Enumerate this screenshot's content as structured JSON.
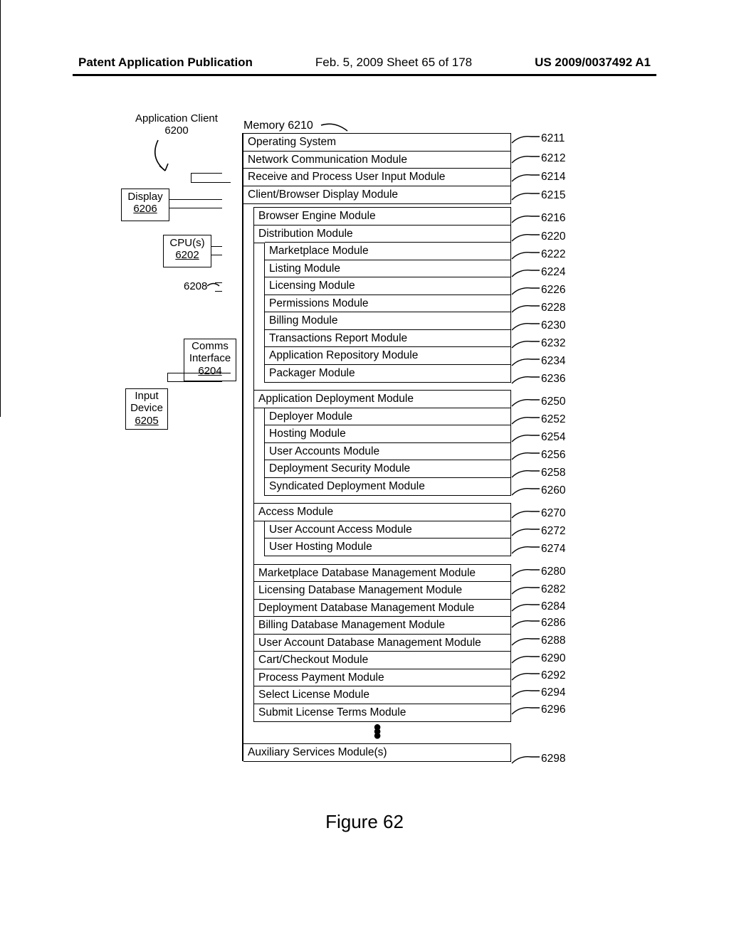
{
  "header": {
    "left": "Patent Application Publication",
    "center": "Feb. 5, 2009   Sheet 65 of 178",
    "right": "US 2009/0037492 A1"
  },
  "app_client": {
    "label": "Application Client",
    "num": "6200"
  },
  "display": {
    "label": "Display",
    "num": "6206"
  },
  "cpu": {
    "label": "CPU(s)",
    "num": "6202"
  },
  "bus_ref": "6208",
  "comms": {
    "l1": "Comms",
    "l2": "Interface",
    "num": "6204"
  },
  "input": {
    "l1": "Input",
    "l2": "Device",
    "num": "6205"
  },
  "memory_label": "Memory 6210",
  "rows": {
    "r6211": "Operating System",
    "r6212": "Network Communication Module",
    "r6214": "Receive and Process User Input Module",
    "r6215": "Client/Browser Display Module",
    "r6216": "Browser Engine Module",
    "r6220": "Distribution Module",
    "r6222": "Marketplace Module",
    "r6224": "Listing Module",
    "r6226": "Licensing Module",
    "r6228": "Permissions Module",
    "r6230": "Billing Module",
    "r6232": "Transactions Report Module",
    "r6234": "Application Repository Module",
    "r6236": "Packager Module",
    "r6250": "Application Deployment Module",
    "r6252": "Deployer Module",
    "r6254": "Hosting Module",
    "r6256": "User Accounts Module",
    "r6258": "Deployment Security Module",
    "r6260": "Syndicated Deployment Module",
    "r6270": "Access Module",
    "r6272": "User Account Access Module",
    "r6274": "User Hosting Module",
    "r6280": "Marketplace Database Management Module",
    "r6282": "Licensing Database Management Module",
    "r6284": "Deployment Database Management Module",
    "r6286": "Billing Database Management Module",
    "r6288": "User Account Database Management Module",
    "r6290": "Cart/Checkout Module",
    "r6292": "Process Payment Module",
    "r6294": "Select License Module",
    "r6296": "Submit License Terms Module",
    "r6298": "Auxiliary Services Module(s)"
  },
  "refs": {
    "r6211": "6211",
    "r6212": "6212",
    "r6214": "6214",
    "r6215": "6215",
    "r6216": "6216",
    "r6220": "6220",
    "r6222": "6222",
    "r6224": "6224",
    "r6226": "6226",
    "r6228": "6228",
    "r6230": "6230",
    "r6232": "6232",
    "r6234": "6234",
    "r6236": "6236",
    "r6250": "6250",
    "r6252": "6252",
    "r6254": "6254",
    "r6256": "6256",
    "r6258": "6258",
    "r6260": "6260",
    "r6270": "6270",
    "r6272": "6272",
    "r6274": "6274",
    "r6280": "6280",
    "r6282": "6282",
    "r6284": "6284",
    "r6286": "6286",
    "r6288": "6288",
    "r6290": "6290",
    "r6292": "6292",
    "r6294": "6294",
    "r6296": "6296",
    "r6298": "6298"
  },
  "figure": "Figure 62"
}
